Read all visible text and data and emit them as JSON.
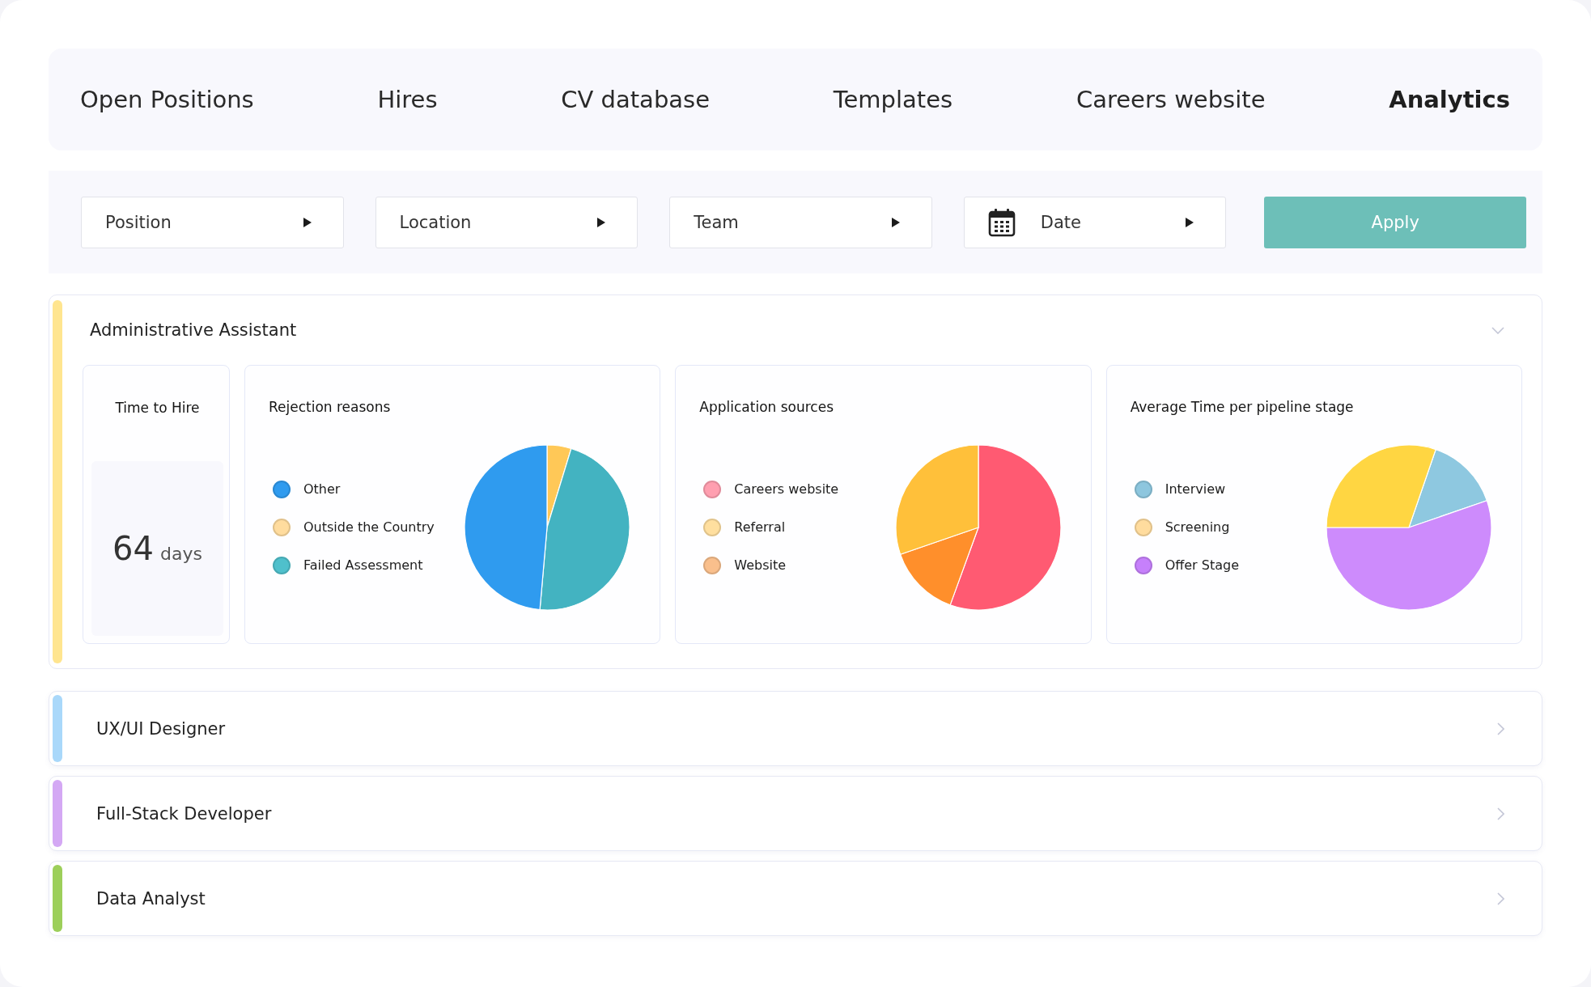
{
  "tabs": [
    {
      "label": "Open Positions",
      "selected": false
    },
    {
      "label": "Hires",
      "selected": false
    },
    {
      "label": "CV database",
      "selected": false
    },
    {
      "label": "Templates",
      "selected": false
    },
    {
      "label": "Careers website",
      "selected": false
    },
    {
      "label": "Analytics",
      "selected": true
    }
  ],
  "filters": [
    {
      "kind": "select",
      "label": "Position"
    },
    {
      "kind": "select",
      "label": "Location"
    },
    {
      "kind": "select",
      "label": "Team"
    },
    {
      "kind": "date",
      "label": "Date"
    }
  ],
  "apply_button": "Apply",
  "sections": [
    {
      "title": "Administrative Assistant",
      "color": "#ffe58f",
      "expanded": true,
      "panels": [
        {
          "kind": "stat",
          "title": "Time to Hire",
          "value": "64",
          "unit": "days"
        },
        {
          "kind": "pie",
          "title": "Rejection reasons",
          "legend": [
            {
              "label": "Other",
              "color": "#2f9bef"
            },
            {
              "label": "Outside the Country",
              "color": "#ffdc9e"
            },
            {
              "label": "Failed Assessment",
              "color": "#4fc0cc"
            }
          ]
        },
        {
          "kind": "pie",
          "title": "Application sources",
          "legend": [
            {
              "label": "Careers website",
              "color": "#ff9fb0"
            },
            {
              "label": "Referral",
              "color": "#ffdf9f"
            },
            {
              "label": "Website",
              "color": "#f9bf8c"
            }
          ]
        },
        {
          "kind": "pie",
          "title": "Average Time per pipeline stage",
          "legend": [
            {
              "label": "Interview",
              "color": "#8dc6de"
            },
            {
              "label": "Screening",
              "color": "#ffdc9e"
            },
            {
              "label": "Offer Stage",
              "color": "#c680fb"
            }
          ]
        }
      ]
    },
    {
      "title": "UX/UI Designer",
      "color": "#a9d8fa",
      "expanded": false
    },
    {
      "title": "Full-Stack Developer",
      "color": "#d4a8f4",
      "expanded": false
    },
    {
      "title": "Data Analyst",
      "color": "#9dcf5a",
      "expanded": false
    }
  ]
}
